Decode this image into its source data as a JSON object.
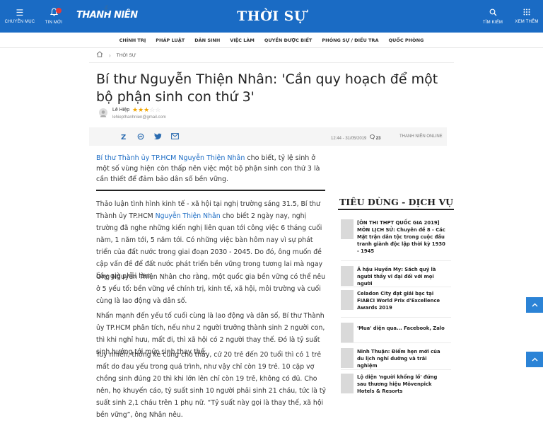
{
  "topbar": {
    "menu_label": "CHUYÊN MỤC",
    "menu_icon": "hamburger-icon",
    "bell_label": "TIN MỚI",
    "bell_icon": "bell-icon",
    "logo": "THANH NIÊN",
    "section_title": "THỜI SỰ",
    "search_label": "TÌM KIẾM",
    "search_icon": "search-icon",
    "more_label": "XEM THÊM",
    "more_icon": "grid-dots-icon",
    "bg_color": "#1a6bc4",
    "badge_color": "#e23b3b"
  },
  "nav": {
    "items": [
      "CHÍNH TRỊ",
      "PHÁP LUẬT",
      "DÂN SINH",
      "VIỆC LÀM",
      "QUYỀN ĐƯỢC BIẾT",
      "PHÓNG SỰ / ĐIỀU TRA",
      "QUỐC PHÒNG"
    ]
  },
  "breadcrumb": {
    "home_icon": "home-icon",
    "current": "THỜI SỰ"
  },
  "article": {
    "headline": "Bí thư Nguyễn Thiện Nhân: 'Cần quy hoạch để một bộ phận sinh con thứ 3'",
    "author": {
      "name": "Lê Hiệp",
      "email": "lehiepthanhnien@gmail.com",
      "rating": 3,
      "rating_max": 5
    },
    "meta": {
      "time": "12:44 - 31/05/2019",
      "comments": "23",
      "source": "THANH NIÊN ONLINE"
    },
    "share_icons": [
      "facebook-icon",
      "zalo-icon",
      "messenger-icon",
      "twitter-icon",
      "email-icon"
    ],
    "sapo_link": "Bí thư Thành ủy TP.HCM Nguyễn Thiện Nhân",
    "sapo_text": " cho biết, tỷ lệ sinh ở một số vùng hiện còn thấp nên việc một bộ phận sinh con thứ 3 là cần thiết để đảm bảo dân số bền vững.",
    "p1_before": "Thảo luận tình hình kinh tế - xã hội tại nghị trường sáng 31.5, Bí thư Thành ủy TP.HCM ",
    "p1_link": "Nguyễn Thiện Nhân",
    "p1_after": " cho biết 2 ngày nay, nghị trường đã nghe những kiến nghị liên quan tới công việc 6 tháng cuối năm, 1 năm tới, 5 năm tới. Có những việc bàn hôm nay vì sự phát triển của đất nước trong giai đoạn 2030 - 2045. Do đó, ông muốn đề cập vấn đề để đất nước phát triển bền vững trong tương lai mà ngay bây giờ phải làm.",
    "p2": "Ông Nguyễn Thiện Nhân cho rằng, một quốc gia bền vững có thể nêu ở 5 yếu tố: bền vững về chính trị, kinh tế, xã hội, môi trường và cuối cùng là lao động và dân số.",
    "p3": "Nhấn mạnh đến yếu tố cuối cùng là lao động và dân số, Bí thư Thành ủy TP.HCM phân tích, nếu như 2 người trưởng thành sinh 2 người con, thì khi nghỉ hưu, mất đi, thì xã hội có 2 người thay thế. Đó là tỷ suất sinh hướng tới mức sinh thay thế.",
    "p4": "Tuy nhiên, thống kê cũng cho thấy, cứ 20 trẻ đến 20 tuổi thì có 1 trẻ mất do đau yếu trong quá trình, như vậy chỉ còn 19 trẻ. 10 cặp vợ chồng sinh đúng 20 thì khi lớn lên chỉ còn 19 trẻ, không có đủ. Cho nên, họ khuyến cáo, tỷ suất sinh 10 người phải sinh 21 cháu, tức là tỷ suất sinh 2,1 cháu trên 1 phụ nữ. “Tỷ suất này gọi là thay thế, xã hội bền vững”, ông Nhân nêu."
  },
  "sidebar": {
    "title": "TIÊU DÙNG - DỊCH VỤ",
    "items": [
      "[ÔN THI THPT QUỐC GIA 2019] MÔN LỊCH SỬ: Chuyên đề 8 - Các Mặt trận dân tộc trong cuộc đấu tranh giành độc lập thời kỳ 1930 - 1945",
      "Á hậu Huyền My: Sách quý là người thầy vĩ đại đối với mọi người",
      "Celadon City đạt giải bạc tại FIABCI World Prix d'Excellence Awards 2019",
      "'Mua' diện qua... Facebook, Zalo",
      "Ninh Thuận: Điểm hẹn mới của du lịch nghỉ dưỡng và trải nghiệm",
      "Lộ diện 'người khổng lồ' đứng sau thương hiệu Mövenpick Hotels & Resorts"
    ]
  },
  "float_buttons": [
    "chevron-up-icon",
    "chevron-up-icon"
  ]
}
